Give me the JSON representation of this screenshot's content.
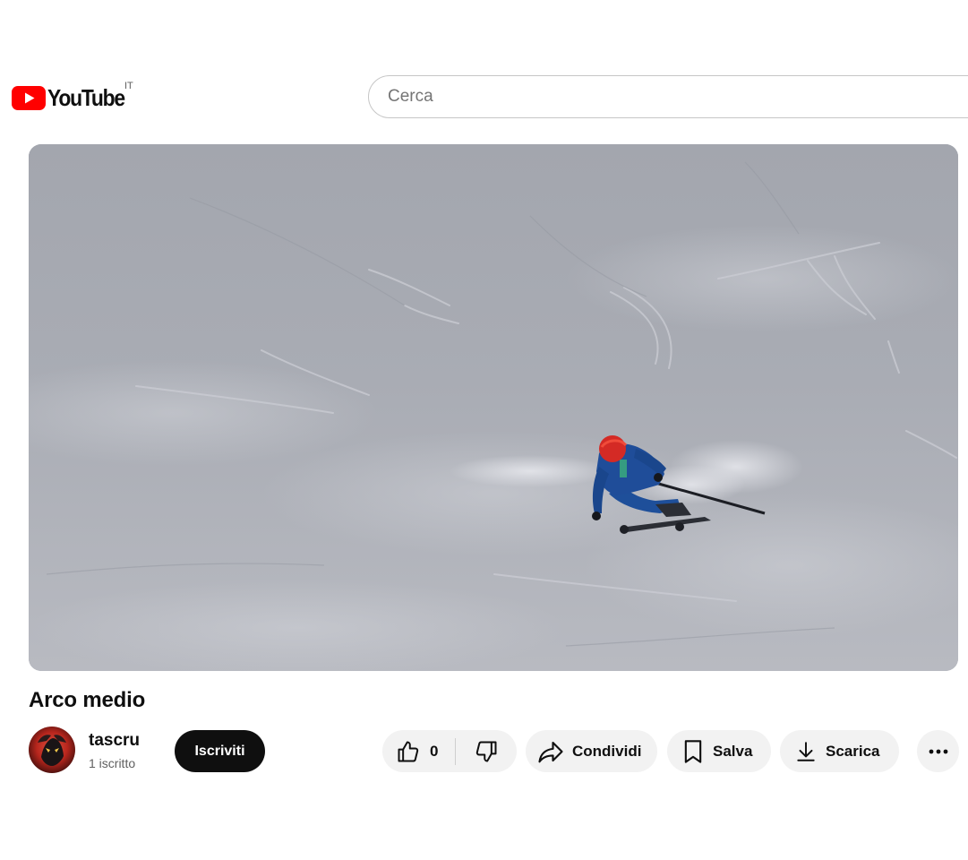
{
  "header": {
    "logo_text": "YouTube",
    "country_code": "IT",
    "search": {
      "placeholder": "Cerca",
      "value": ""
    },
    "brand_color": "#ff0000"
  },
  "video": {
    "title": "Arco medio",
    "player_icon": "video-frame",
    "player_subject": "skier-carving-turn-on-snow"
  },
  "channel": {
    "name": "tascru",
    "subscribers": "1 iscritto",
    "subscribe_label": "Iscriviti"
  },
  "actions": {
    "like_icon": "thumbs-up-icon",
    "like_count": "0",
    "dislike_icon": "thumbs-down-icon",
    "share_label": "Condividi",
    "share_icon": "share-arrow-icon",
    "save_label": "Salva",
    "save_icon": "bookmark-icon",
    "download_label": "Scarica",
    "download_icon": "download-icon",
    "more_icon": "more-horizontal-icon"
  }
}
